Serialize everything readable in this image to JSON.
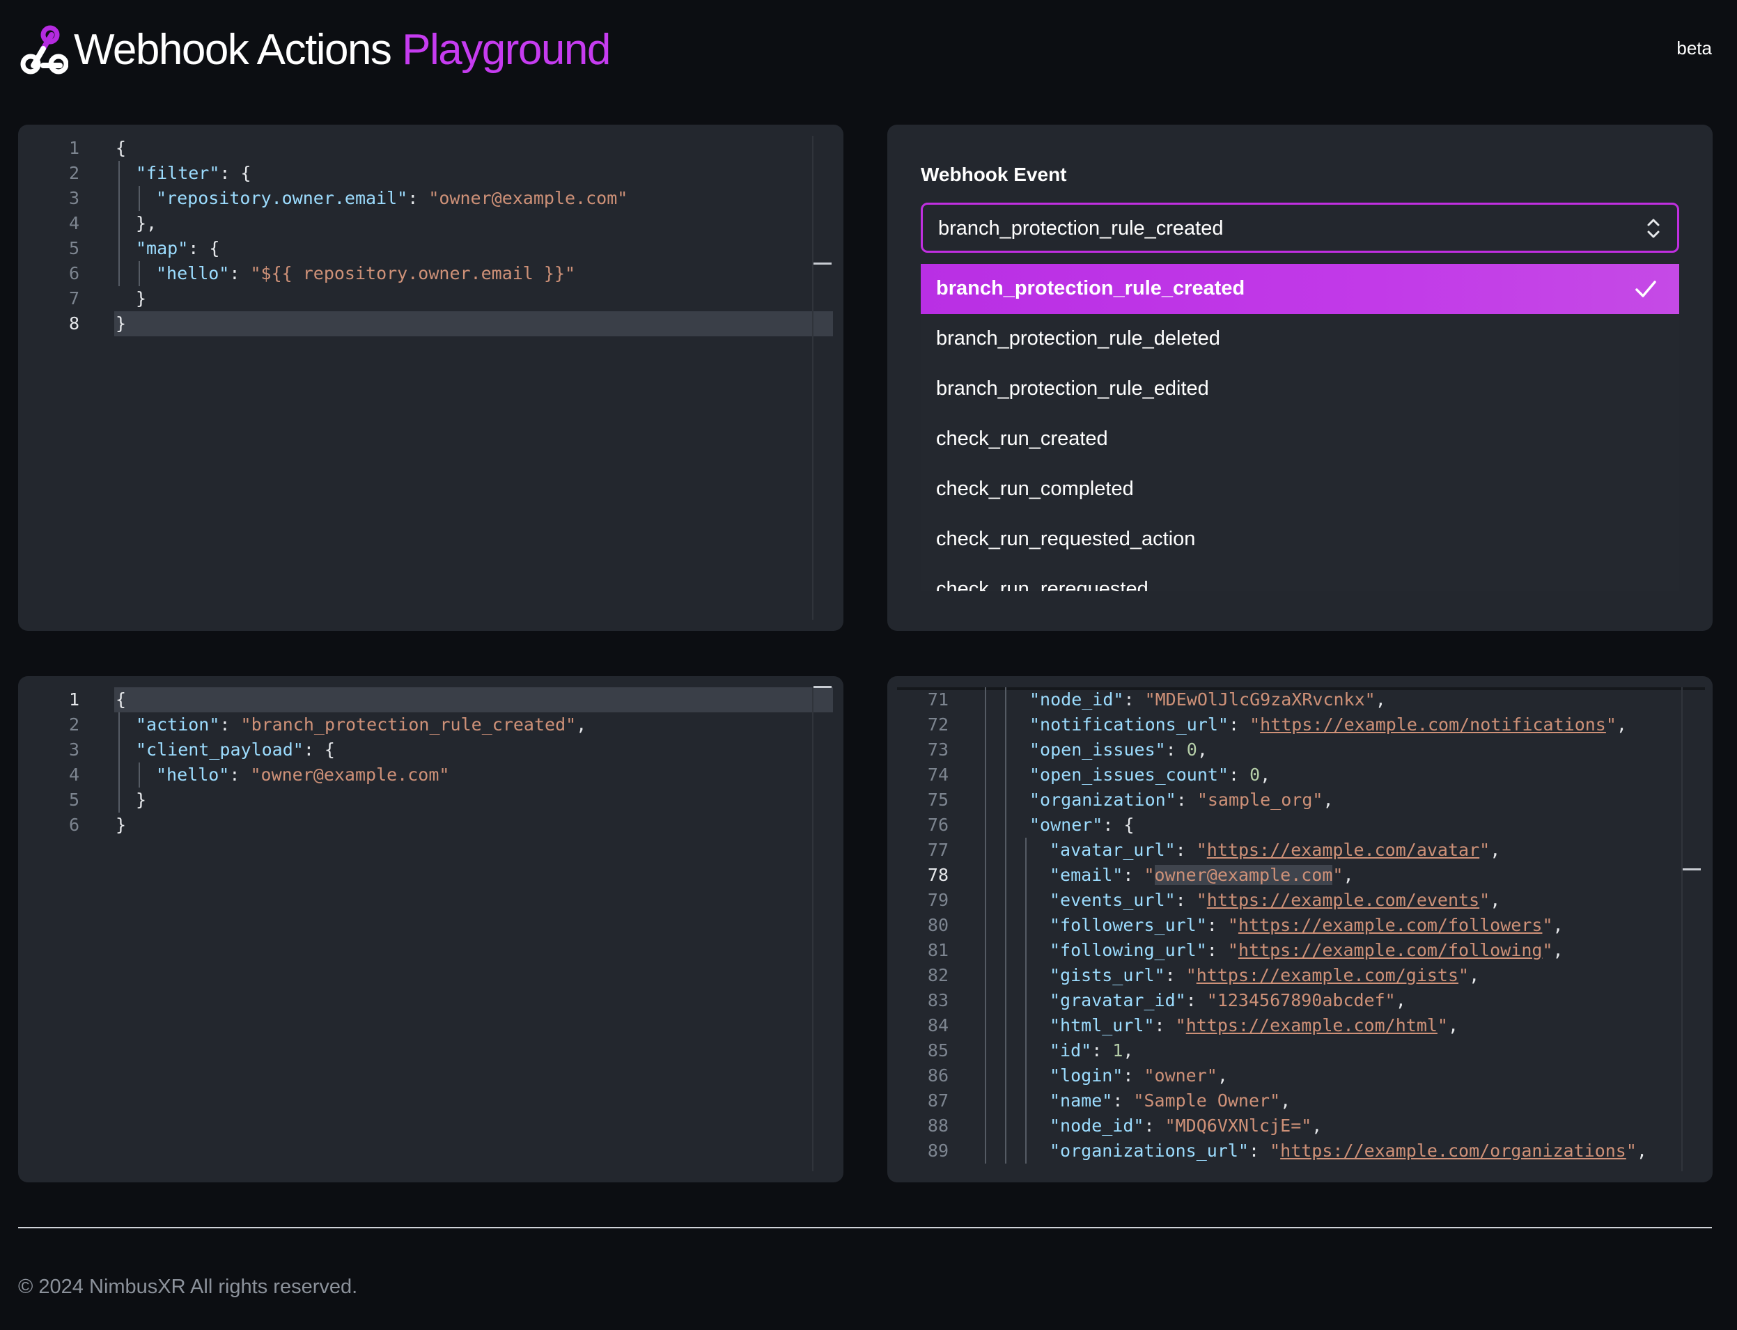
{
  "header": {
    "title_part1": "Webhook Actions",
    "title_part2": "Playground",
    "badge": "beta",
    "logo_icon": "webhook-icon",
    "accent_color": "#c63cf0"
  },
  "filter_editor": {
    "active_line": 8,
    "lines": [
      {
        "n": "1"
      },
      {
        "n": "2"
      },
      {
        "n": "3"
      },
      {
        "n": "4"
      },
      {
        "n": "5"
      },
      {
        "n": "6"
      },
      {
        "n": "7"
      },
      {
        "n": "8"
      }
    ],
    "tokens": {
      "open": "{",
      "filter_key": "\"filter\"",
      "owner_email_key": "\"repository.owner.email\"",
      "owner_email_val": "\"owner@example.com\"",
      "close_comma": "},",
      "map_key": "\"map\"",
      "hello_key": "\"hello\"",
      "hello_val": "\"${{ repository.owner.email }}\"",
      "close_inner": "}",
      "close": "}",
      "colon_brace": ": {",
      "colon": ": "
    }
  },
  "webhook_event": {
    "label": "Webhook Event",
    "selected": "branch_protection_rule_created",
    "options": [
      "branch_protection_rule_created",
      "branch_protection_rule_deleted",
      "branch_protection_rule_edited",
      "check_run_created",
      "check_run_completed",
      "check_run_requested_action",
      "check_run_rerequested"
    ],
    "check_icon": "checkmark-icon",
    "chevron_icon": "chevron-up-down-icon"
  },
  "output_editor": {
    "active_line": 1,
    "lines": [
      {
        "n": "1"
      },
      {
        "n": "2"
      },
      {
        "n": "3"
      },
      {
        "n": "4"
      },
      {
        "n": "5"
      },
      {
        "n": "6"
      }
    ],
    "tokens": {
      "open": "{",
      "action_key": "\"action\"",
      "action_val": "\"branch_protection_rule_created\"",
      "client_payload_key": "\"client_payload\"",
      "hello_key": "\"hello\"",
      "hello_val": "\"owner@example.com\"",
      "close_inner": "}",
      "close": "}"
    }
  },
  "payload_editor": {
    "active_line": 78,
    "lines": [
      {
        "n": "71",
        "key": "\"node_id\"",
        "val": "\"MDEwOlJlcG9zaXRvcnkx\"",
        "type": "s",
        "indent": 1
      },
      {
        "n": "72",
        "key": "\"notifications_url\"",
        "val": "https://example.com/notifications",
        "type": "u",
        "indent": 1
      },
      {
        "n": "73",
        "key": "\"open_issues\"",
        "val": "0",
        "type": "n",
        "indent": 1
      },
      {
        "n": "74",
        "key": "\"open_issues_count\"",
        "val": "0",
        "type": "n",
        "indent": 1
      },
      {
        "n": "75",
        "key": "\"organization\"",
        "val": "\"sample_org\"",
        "type": "s",
        "indent": 1
      },
      {
        "n": "76",
        "key": "\"owner\"",
        "val": "{",
        "type": "brace",
        "indent": 1
      },
      {
        "n": "77",
        "key": "\"avatar_url\"",
        "val": "https://example.com/avatar",
        "type": "u",
        "indent": 2
      },
      {
        "n": "78",
        "key": "\"email\"",
        "val": "owner@example.com",
        "type": "sel",
        "indent": 2
      },
      {
        "n": "79",
        "key": "\"events_url\"",
        "val": "https://example.com/events",
        "type": "u",
        "indent": 2
      },
      {
        "n": "80",
        "key": "\"followers_url\"",
        "val": "https://example.com/followers",
        "type": "u",
        "indent": 2
      },
      {
        "n": "81",
        "key": "\"following_url\"",
        "val": "https://example.com/following",
        "type": "u",
        "indent": 2
      },
      {
        "n": "82",
        "key": "\"gists_url\"",
        "val": "https://example.com/gists",
        "type": "u",
        "indent": 2
      },
      {
        "n": "83",
        "key": "\"gravatar_id\"",
        "val": "\"1234567890abcdef\"",
        "type": "s",
        "indent": 2
      },
      {
        "n": "84",
        "key": "\"html_url\"",
        "val": "https://example.com/html",
        "type": "u",
        "indent": 2
      },
      {
        "n": "85",
        "key": "\"id\"",
        "val": "1",
        "type": "n",
        "indent": 2
      },
      {
        "n": "86",
        "key": "\"login\"",
        "val": "\"owner\"",
        "type": "s",
        "indent": 2
      },
      {
        "n": "87",
        "key": "\"name\"",
        "val": "\"Sample Owner\"",
        "type": "s",
        "indent": 2
      },
      {
        "n": "88",
        "key": "\"node_id\"",
        "val": "\"MDQ6VXNlcjE=\"",
        "type": "s",
        "indent": 2
      },
      {
        "n": "89",
        "key": "\"organizations_url\"",
        "val": "https://example.com/organizations",
        "type": "u",
        "indent": 2
      }
    ]
  },
  "footer": {
    "copyright": "© 2024 NimbusXR All rights reserved."
  }
}
